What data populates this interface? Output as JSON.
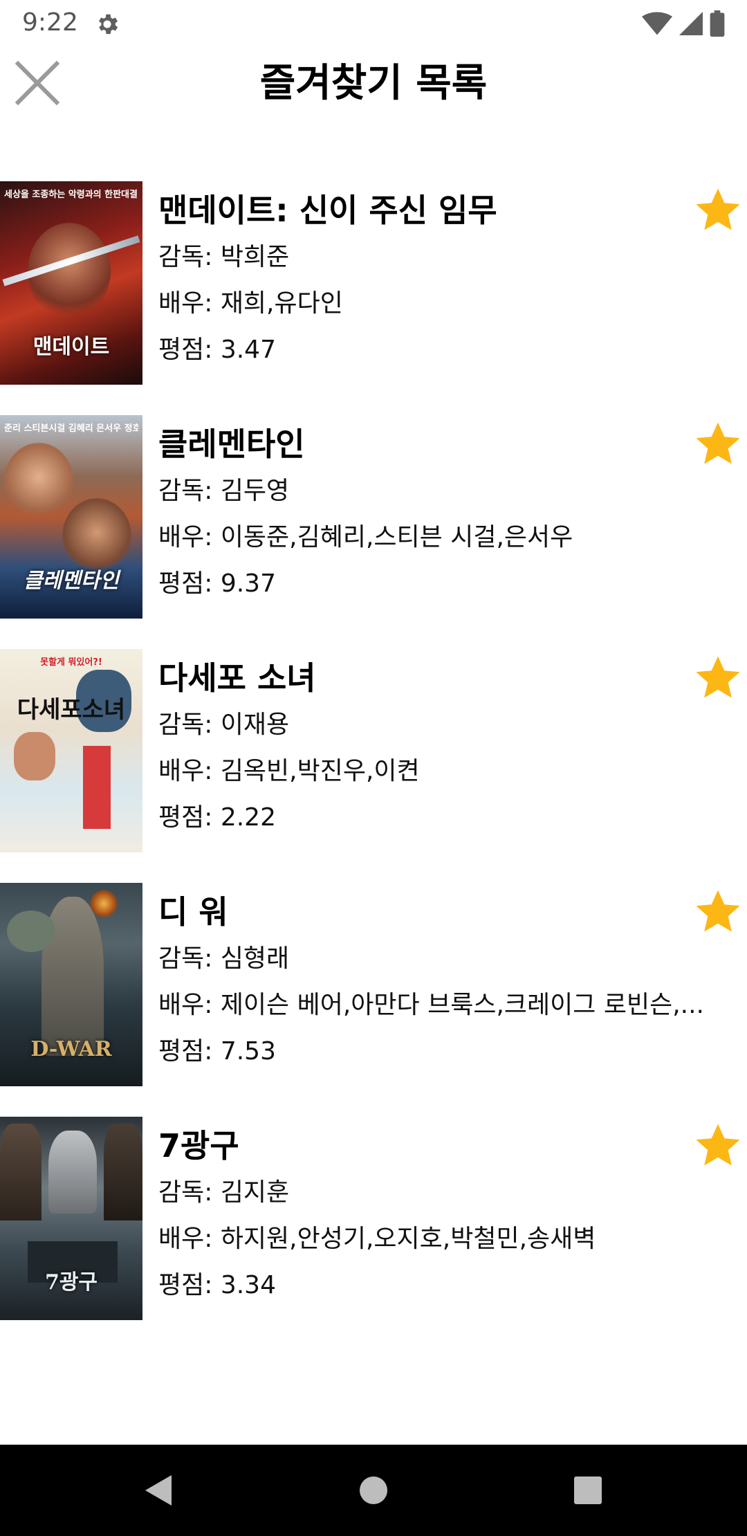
{
  "status_bar": {
    "time": "9:22",
    "icons": [
      "gear-icon",
      "wifi-icon",
      "cellular-icon",
      "battery-icon"
    ]
  },
  "toolbar": {
    "title": "즐겨찾기 목록",
    "close_icon": "close-icon"
  },
  "colors": {
    "star": "#FDB714",
    "nav_bar": "#000000"
  },
  "labels": {
    "director": "감독: ",
    "actors": "배우: ",
    "rating": "평점: "
  },
  "movies": [
    {
      "title": "맨데이트: 신이 주신 임무",
      "director": "박희준",
      "actors": "재희,유다인",
      "rating": "3.47",
      "favorited": true,
      "poster_caption": "맨데이트",
      "poster_tagline": "세상을 조종하는 악령과의 한판대결!"
    },
    {
      "title": "클레멘타인",
      "director": "김두영",
      "actors": "이동준,김혜리,스티븐 시걸,은서우",
      "rating": "9.37",
      "favorited": true,
      "poster_caption": "클레멘타인",
      "poster_tagline": "준리 스티븐시걸 김혜리 은서우 정호"
    },
    {
      "title": "다세포 소녀",
      "director": "이재용",
      "actors": "김옥빈,박진우,이켠",
      "rating": "2.22",
      "favorited": true,
      "poster_caption": "다세포소녀",
      "poster_tagline": "못할게 뭐있어?!"
    },
    {
      "title": "디 워",
      "director": "심형래",
      "actors": "제이슨 베어,아만다 브룩스,크레이그 로빈슨,...",
      "rating": "7.53",
      "favorited": true,
      "poster_caption": "D-WAR",
      "poster_tagline": ""
    },
    {
      "title": "7광구",
      "director": "김지훈",
      "actors": "하지원,안성기,오지호,박철민,송새벽",
      "rating": "3.34",
      "favorited": true,
      "poster_caption": "7광구",
      "poster_tagline": ""
    }
  ],
  "nav_bar": {
    "icons": [
      "back-icon",
      "home-icon",
      "recents-icon"
    ]
  }
}
